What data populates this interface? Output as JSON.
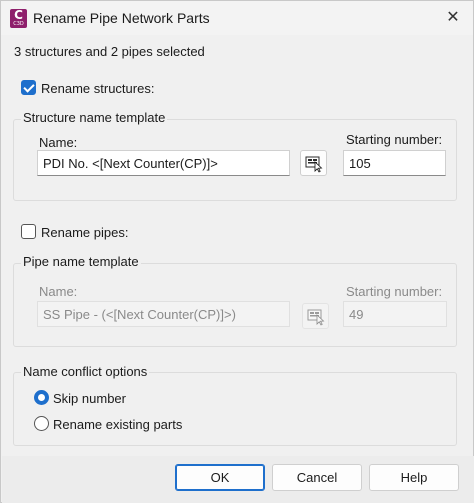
{
  "window": {
    "title": "Rename Pipe Network Parts",
    "icon_letter": "C",
    "icon_sub": "C3D",
    "close_glyph": "✕"
  },
  "summary": "3 structures and 2 pipes selected",
  "structures": {
    "checkbox_label": "Rename structures:",
    "checked": true,
    "group_title": "Structure name template",
    "name_label": "Name:",
    "name_value": "PDI No. <[Next Counter(CP)]>",
    "start_label": "Starting number:",
    "start_value": "105",
    "editor_icon": "name-template-editor-icon"
  },
  "pipes": {
    "checkbox_label": "Rename pipes:",
    "checked": false,
    "group_title": "Pipe name template",
    "name_label": "Name:",
    "name_value": "SS Pipe - (<[Next Counter(CP)]>)",
    "start_label": "Starting number:",
    "start_value": "49",
    "editor_icon": "name-template-editor-icon"
  },
  "conflict": {
    "group_title": "Name conflict options",
    "options": [
      {
        "label": "Skip number",
        "selected": true
      },
      {
        "label": "Rename existing parts",
        "selected": false
      }
    ]
  },
  "buttons": {
    "ok": "OK",
    "cancel": "Cancel",
    "help": "Help"
  },
  "colors": {
    "accent": "#1e6fcc",
    "app_icon": "#8e1f6b"
  }
}
